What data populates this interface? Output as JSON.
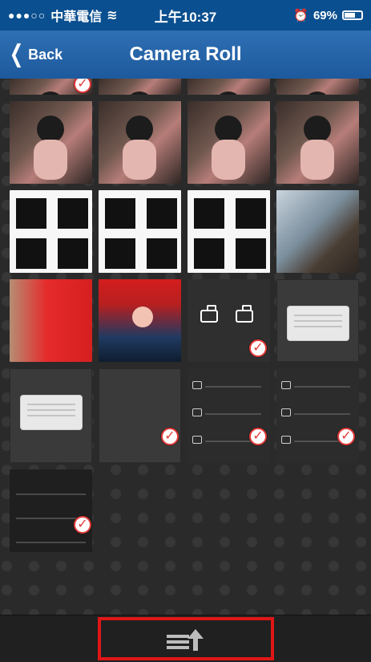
{
  "status_bar": {
    "carrier": "中華電信",
    "time": "上午10:37",
    "battery": "69%"
  },
  "nav": {
    "back_label": "Back",
    "title": "Camera Roll"
  },
  "icons": {
    "wifi": "wifi-icon",
    "alarm": "alarm-icon",
    "battery": "battery-icon",
    "back": "chevron-left-icon",
    "check": "check-icon",
    "upload": "upload-icon"
  }
}
